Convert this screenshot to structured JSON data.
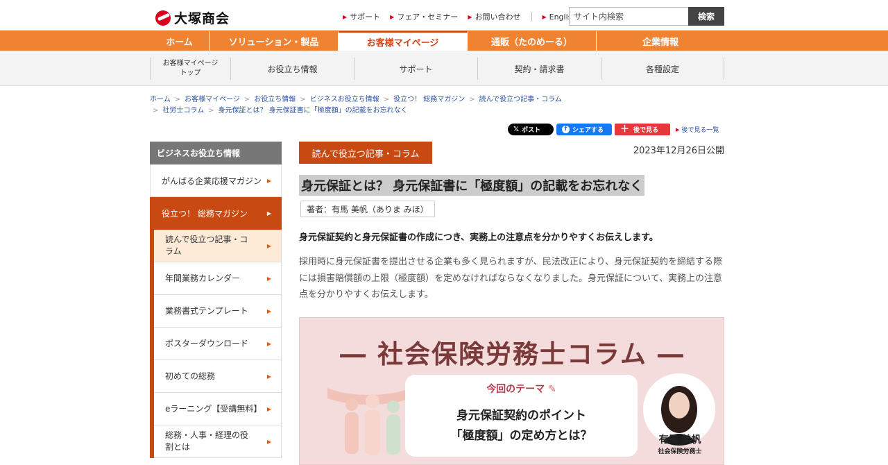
{
  "header": {
    "logo_text": "大塚商会",
    "util_links": [
      "サポート",
      "フェア・セミナー",
      "お問い合わせ"
    ],
    "english": "English",
    "search_placeholder": "サイト内検索",
    "search_button": "検索"
  },
  "gnav": [
    {
      "label": "ホーム",
      "active": false
    },
    {
      "label": "ソリューション・製品",
      "active": false
    },
    {
      "label": "お客様マイページ",
      "active": true
    },
    {
      "label": "通販（たのめーる）",
      "active": false
    },
    {
      "label": "企業情報",
      "active": false
    }
  ],
  "subnav": {
    "top_line1": "お客様マイページ",
    "top_line2": "トップ",
    "items": [
      "お役立ち情報",
      "サポート",
      "契約・請求書",
      "各種設定"
    ]
  },
  "breadcrumb": {
    "row1": [
      "ホーム",
      "お客様マイページ",
      "お役立ち情報",
      "ビジネスお役立ち情報",
      "役立つ！ 総務マガジン",
      "読んで役立つ記事・コラム"
    ],
    "row2": [
      "社労士コラム",
      "身元保証とは？ 身元保証書に「極度額」の記載をお忘れなく"
    ]
  },
  "social": {
    "x_label": "ポスト",
    "fb_label": "シェアする",
    "later_label": "後で見る",
    "later_list": "後で見る一覧"
  },
  "sidebar": {
    "heading": "ビジネスお役立ち情報",
    "item_top": "がんばる企業応援マガジン",
    "item_active": "役立つ！ 総務マガジン",
    "subitems": [
      "読んで役立つ記事・コラム",
      "年間業務カレンダー",
      "業務書式テンプレート",
      "ポスターダウンロード",
      "初めての総務",
      "eラーニング【受講無料】",
      "総務・人事・経理の役割とは"
    ]
  },
  "article": {
    "category": "読んで役立つ記事・コラム",
    "date": "2023年12月26日公開",
    "title": "身元保証とは？ 身元保証書に「極度額」の記載をお忘れなく",
    "author": "著者：有馬 美帆（ありま みほ）",
    "lead": "身元保証契約と身元保証書の作成につき、実務上の注意点を分かりやすくお伝えします。",
    "body": "採用時に身元保証書を提出させる企業も多く見られますが、民法改正により、身元保証契約を締結する際には損害賠償額の上限（極度額）を定めなければならなくなりました。身元保証について、実務上の注意点を分かりやすくお伝えします。"
  },
  "banner": {
    "title": "― 社会保険労務士コラム ―",
    "theme_label": "今回のテーマ",
    "theme_line1": "身元保証契約のポイント",
    "theme_line2": "「極度額」の定め方とは？",
    "author_name": "有馬 美帆",
    "author_role": "社会保険労務士"
  },
  "colors": {
    "brand_red": "#d7001d",
    "nav_orange": "#f08332",
    "accent": "#c84a12",
    "link": "#2a4fa0"
  }
}
